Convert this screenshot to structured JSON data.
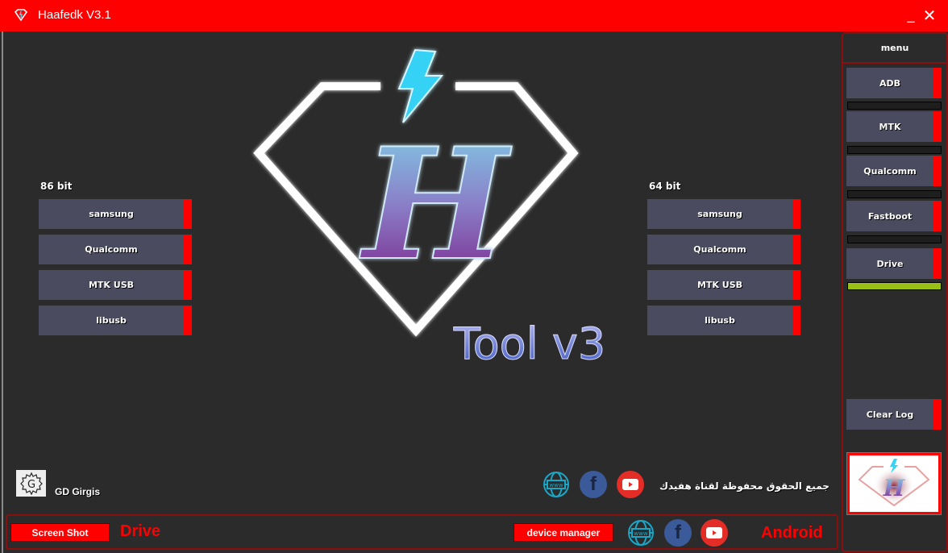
{
  "window": {
    "title": "Haafedk V3.1",
    "minimize_label": "_",
    "close_label": "✕",
    "app_icon": "diamond-logo-icon"
  },
  "left_panel": {
    "label": "86 bit",
    "buttons": [
      "samsung",
      "Qualcomm",
      "MTK USB",
      "libusb"
    ]
  },
  "right_panel": {
    "label": "64 bit",
    "buttons": [
      "samsung",
      "Qualcomm",
      "MTK USB",
      "libusb"
    ]
  },
  "logo": {
    "text": "Tool v3",
    "letter": "H"
  },
  "author": {
    "name": "GD Girgis",
    "icon": "gear-g-icon"
  },
  "footer": {
    "copyright_arabic": "جميع الحقوق محفوظة لقناة هفيدك",
    "social_icons": [
      "www-globe-icon",
      "facebook-icon",
      "youtube-icon"
    ]
  },
  "bottom_bar": {
    "screenshot_label": "Screen Shot",
    "drive_label": "Drive",
    "device_manager_label": "device manager",
    "android_label": "Android",
    "social_icons": [
      "www-globe-icon",
      "facebook-icon",
      "youtube-icon"
    ],
    "www_text": "www"
  },
  "sidebar": {
    "title": "menu",
    "items": [
      {
        "label": "ADB",
        "progress": 0
      },
      {
        "label": "MTK",
        "progress": 0
      },
      {
        "label": "Qualcomm",
        "progress": 0
      },
      {
        "label": "Fastboot",
        "progress": 0
      },
      {
        "label": "Drive",
        "progress": 100
      }
    ],
    "clear_log_label": "Clear Log"
  },
  "colors": {
    "accent": "#ff0000",
    "button_bg": "#4a4b5e",
    "background": "#2b2b2b",
    "progress_fill": "#9abf16",
    "border_dark_red": "#8b0f0f"
  }
}
